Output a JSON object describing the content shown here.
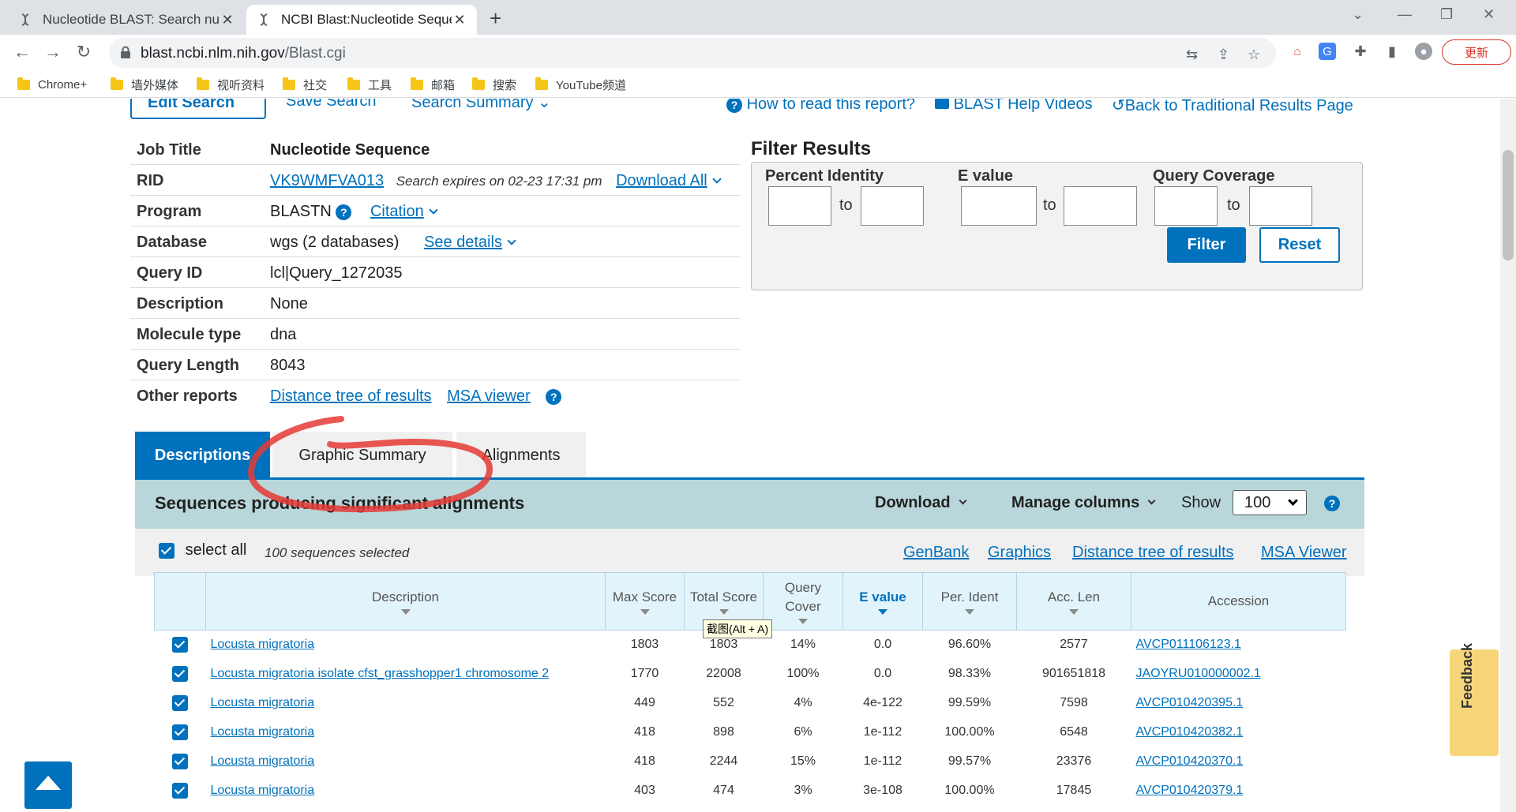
{
  "browser": {
    "tabs": [
      {
        "title": "Nucleotide BLAST: Search nucl",
        "active": false
      },
      {
        "title": "NCBI Blast:Nucleotide Sequenc",
        "active": true
      }
    ],
    "url_host": "blast.ncbi.nlm.nih.gov",
    "url_path": "/Blast.cgi",
    "update_label": "更新",
    "bookmarks": [
      "Chrome+",
      "墙外媒体",
      "视听资料",
      "社交",
      "工具",
      "邮箱",
      "搜索",
      "YouTube频道"
    ]
  },
  "top": {
    "edit_search": "Edit Search",
    "save_search": "Save Search",
    "search_summary": "Search Summary",
    "how_to_read": "How to read this report?",
    "help_videos": "BLAST Help Videos",
    "back_traditional": "Back to Traditional Results Page"
  },
  "job": {
    "labels": {
      "job_title": "Job Title",
      "rid": "RID",
      "program": "Program",
      "database": "Database",
      "query_id": "Query ID",
      "description": "Description",
      "molecule_type": "Molecule type",
      "query_length": "Query Length",
      "other_reports": "Other reports"
    },
    "job_title": "Nucleotide Sequence",
    "rid": "VK9WMFVA013",
    "expires": "Search expires on 02-23 17:31 pm",
    "download_all": "Download All",
    "program": "BLASTN",
    "citation": "Citation",
    "database": "wgs (2 databases)",
    "see_details": "See details",
    "query_id": "lcl|Query_1272035",
    "description": "None",
    "molecule_type": "dna",
    "query_length": "8043",
    "distance_tree": "Distance tree of results",
    "msa_viewer": "MSA viewer"
  },
  "filter": {
    "title": "Filter Results",
    "percent_identity": "Percent Identity",
    "e_value": "E value",
    "query_coverage": "Query Coverage",
    "to": "to",
    "filter_btn": "Filter",
    "reset_btn": "Reset"
  },
  "result_tabs": [
    "Descriptions",
    "Graphic Summary",
    "Alignments"
  ],
  "seq": {
    "title": "Sequences producing significant alignments",
    "download": "Download",
    "manage_columns": "Manage columns",
    "show": "Show",
    "show_value": "100",
    "select_all": "select all",
    "selected_count": "100 sequences selected",
    "links": [
      "GenBank",
      "Graphics",
      "Distance tree of results",
      "MSA Viewer"
    ]
  },
  "table": {
    "headers": {
      "description": "Description",
      "max_score": "Max Score",
      "total_score": "Total Score",
      "query_cover_1": "Query",
      "query_cover_2": "Cover",
      "e_value": "E value",
      "per_ident": "Per. Ident",
      "acc_len": "Acc. Len",
      "accession": "Accession"
    },
    "rows": [
      {
        "desc": "Locusta migratoria",
        "max": "1803",
        "total": "1803",
        "cover": "14%",
        "e": "0.0",
        "ident": "96.60%",
        "len": "2577",
        "acc": "AVCP011106123.1"
      },
      {
        "desc": "Locusta migratoria isolate cfst_grasshopper1 chromosome 2",
        "max": "1770",
        "total": "22008",
        "cover": "100%",
        "e": "0.0",
        "ident": "98.33%",
        "len": "901651818",
        "acc": "JAOYRU010000002.1"
      },
      {
        "desc": "Locusta migratoria",
        "max": "449",
        "total": "552",
        "cover": "4%",
        "e": "4e-122",
        "ident": "99.59%",
        "len": "7598",
        "acc": "AVCP010420395.1"
      },
      {
        "desc": "Locusta migratoria",
        "max": "418",
        "total": "898",
        "cover": "6%",
        "e": "1e-112",
        "ident": "100.00%",
        "len": "6548",
        "acc": "AVCP010420382.1"
      },
      {
        "desc": "Locusta migratoria",
        "max": "418",
        "total": "2244",
        "cover": "15%",
        "e": "1e-112",
        "ident": "99.57%",
        "len": "23376",
        "acc": "AVCP010420370.1"
      },
      {
        "desc": "Locusta migratoria",
        "max": "403",
        "total": "474",
        "cover": "3%",
        "e": "3e-108",
        "ident": "100.00%",
        "len": "17845",
        "acc": "AVCP010420379.1"
      }
    ]
  },
  "tooltip": "截图(Alt + A)",
  "feedback": "Feedback",
  "colors": {
    "ncbi_blue": "#0071bc",
    "header_teal": "#b9d7da",
    "annotation_red": "#e53935"
  }
}
